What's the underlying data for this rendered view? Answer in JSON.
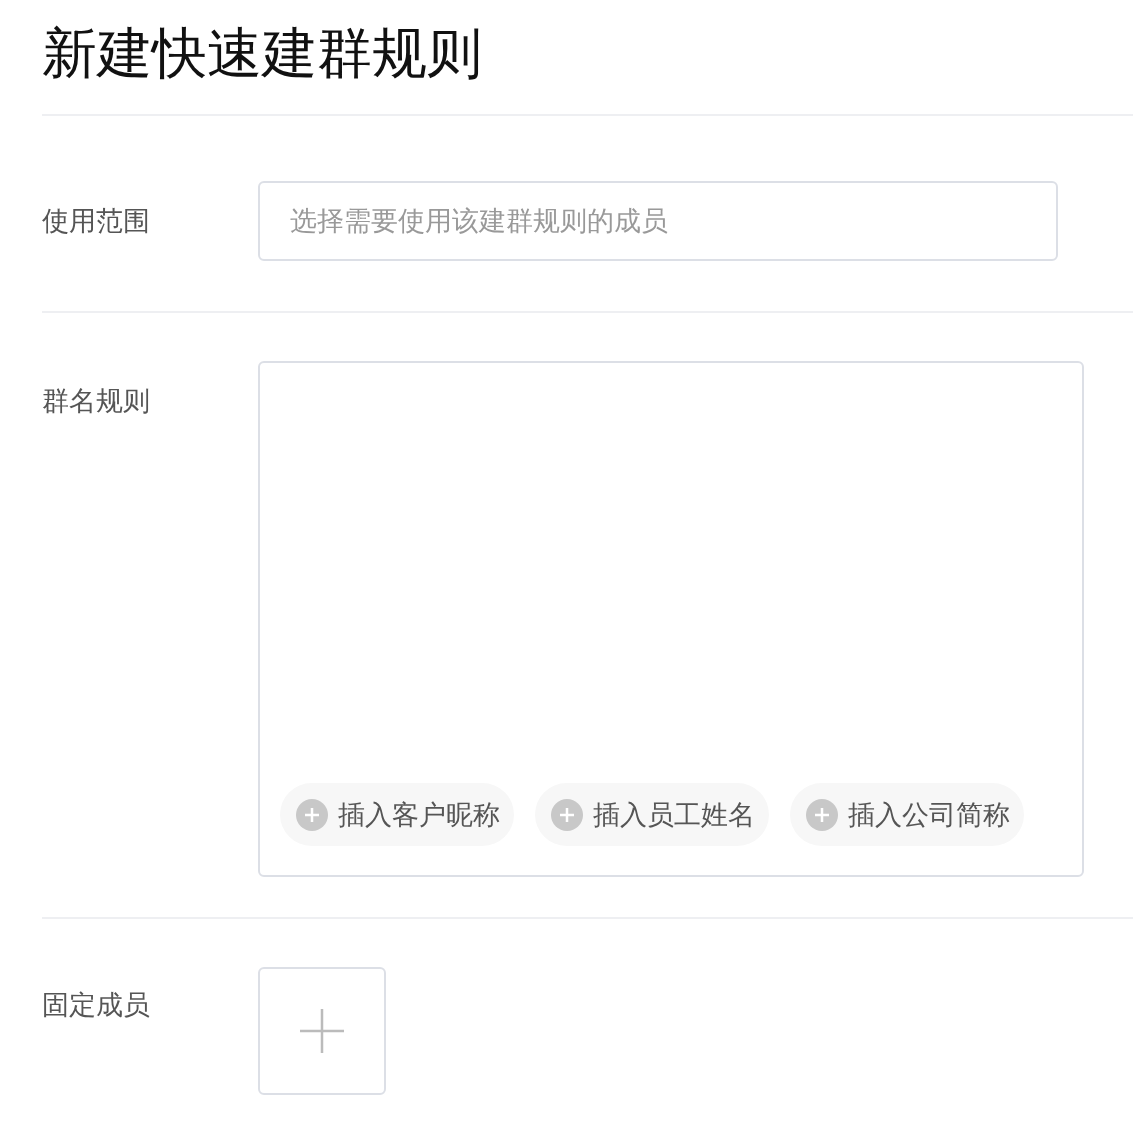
{
  "title": "新建快速建群规则",
  "fields": [
    {
      "kind": "select",
      "label": "使用范围",
      "placeholder": "选择需要使用该建群规则的成员"
    },
    {
      "kind": "template",
      "label": "群名规则",
      "inserts": [
        "插入客户昵称",
        "插入员工姓名",
        "插入公司简称"
      ]
    },
    {
      "kind": "add",
      "label": "固定成员"
    }
  ]
}
